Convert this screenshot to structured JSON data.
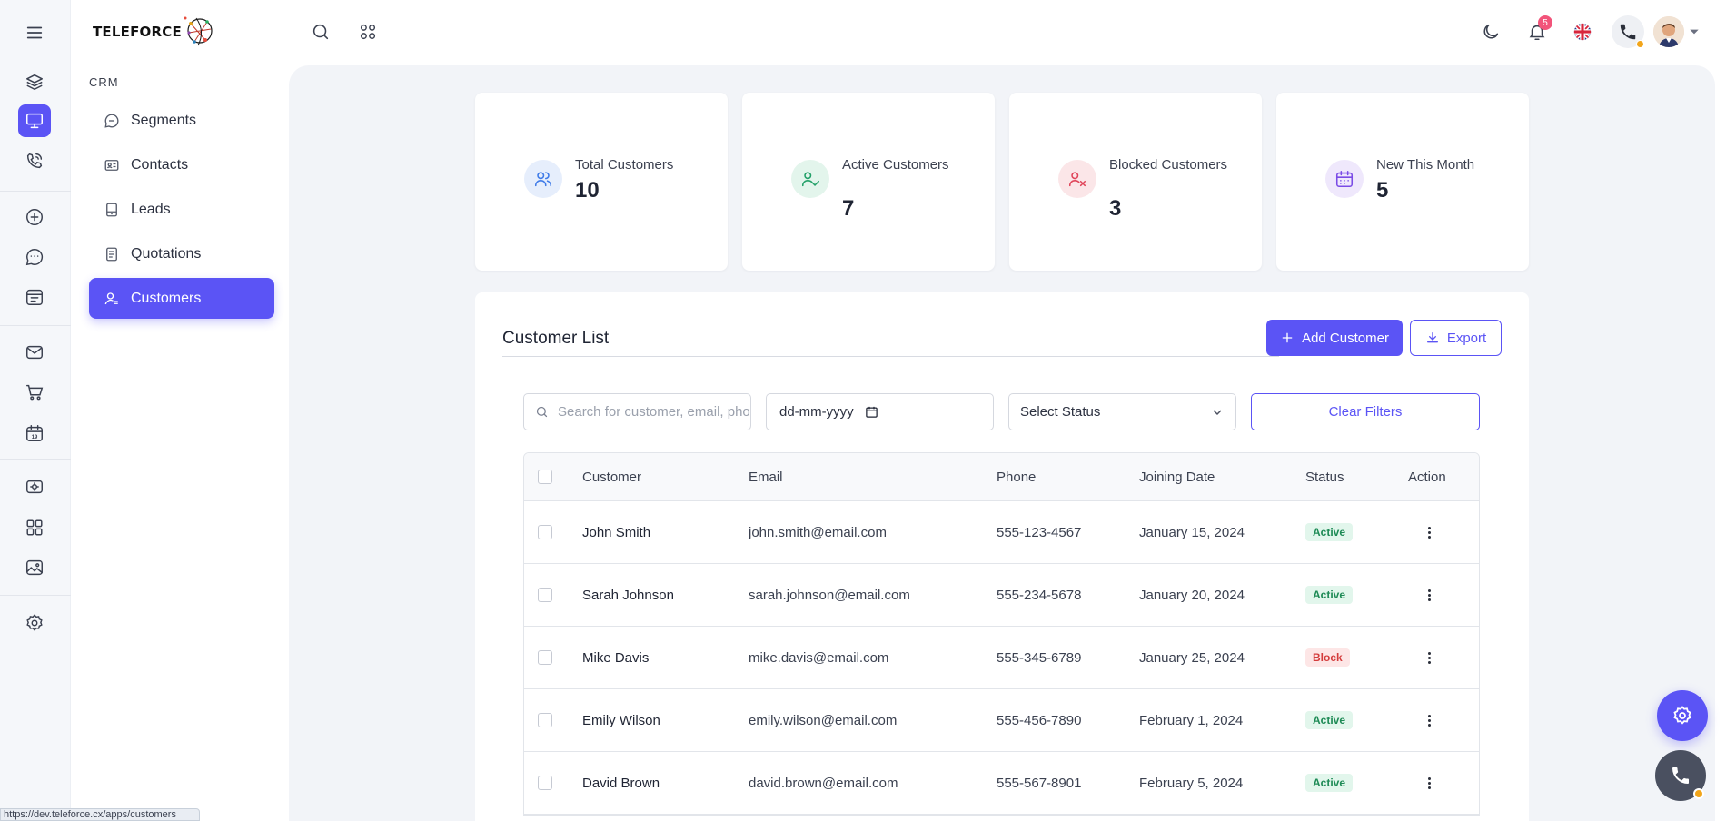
{
  "brand": {
    "name": "TELEFORCE"
  },
  "sidebar": {
    "section_label": "CRM",
    "items": [
      {
        "label": "Segments",
        "icon": "chat-bubble-icon"
      },
      {
        "label": "Contacts",
        "icon": "id-card-icon"
      },
      {
        "label": "Leads",
        "icon": "tablet-icon"
      },
      {
        "label": "Quotations",
        "icon": "document-icon"
      },
      {
        "label": "Customers",
        "icon": "user-icon",
        "active": true
      }
    ]
  },
  "header": {
    "notification_count": "5"
  },
  "stats": [
    {
      "label": "Total Customers",
      "value": "10",
      "icon": "users-icon",
      "color": "#3f7be8"
    },
    {
      "label": "Active Customers",
      "value": "7",
      "icon": "user-check-icon",
      "color": "#22a068"
    },
    {
      "label": "Blocked Customers",
      "value": "3",
      "icon": "user-x-icon",
      "color": "#e0455a"
    },
    {
      "label": "New This Month",
      "value": "5",
      "icon": "calendar-icon",
      "color": "#7a4be6"
    }
  ],
  "customer_list": {
    "title": "Customer List",
    "add_label": "Add Customer",
    "export_label": "Export",
    "search_placeholder": "Search for customer, email, phone",
    "date_placeholder": "dd-mm-yyyy",
    "status_select": "Select Status",
    "clear_label": "Clear Filters",
    "columns": [
      "Customer",
      "Email",
      "Phone",
      "Joining Date",
      "Status",
      "Action"
    ],
    "rows": [
      {
        "name": "John Smith",
        "email": "john.smith@email.com",
        "phone": "555-123-4567",
        "date": "January 15, 2024",
        "status": "Active"
      },
      {
        "name": "Sarah Johnson",
        "email": "sarah.johnson@email.com",
        "phone": "555-234-5678",
        "date": "January 20, 2024",
        "status": "Active"
      },
      {
        "name": "Mike Davis",
        "email": "mike.davis@email.com",
        "phone": "555-345-6789",
        "date": "January 25, 2024",
        "status": "Block"
      },
      {
        "name": "Emily Wilson",
        "email": "emily.wilson@email.com",
        "phone": "555-456-7890",
        "date": "February 1, 2024",
        "status": "Active"
      },
      {
        "name": "David Brown",
        "email": "david.brown@email.com",
        "phone": "555-567-8901",
        "date": "February 5, 2024",
        "status": "Active"
      }
    ]
  },
  "status_bar": {
    "url": "https://dev.teleforce.cx/apps/customers"
  },
  "colors": {
    "accent": "#5b54f5",
    "active_badge": "#1d8a55",
    "block_badge": "#d43c3c"
  }
}
